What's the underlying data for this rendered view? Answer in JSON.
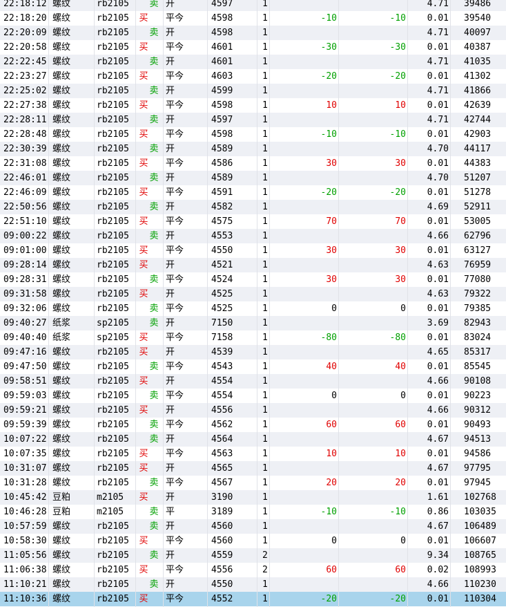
{
  "colors": {
    "buy": "#e00000",
    "sell": "#00a000",
    "profit": "#e00000",
    "loss": "#00a000",
    "row_alt": "#eef0f5",
    "row_selected": "#a8d4ec"
  },
  "rows": [
    {
      "time": "22:18:12",
      "name": "螺纹",
      "code": "rb2105",
      "buy": "",
      "sell": "卖",
      "oc": "开",
      "price": "4597",
      "qty": "1",
      "pl1": "",
      "pl2": "",
      "fee": "4.71",
      "total": "39486"
    },
    {
      "time": "22:18:20",
      "name": "螺纹",
      "code": "rb2105",
      "buy": "买",
      "sell": "",
      "oc": "平今",
      "price": "4598",
      "qty": "1",
      "pl1": "-10",
      "pl2": "-10",
      "fee": "0.01",
      "total": "39540"
    },
    {
      "time": "22:20:09",
      "name": "螺纹",
      "code": "rb2105",
      "buy": "",
      "sell": "卖",
      "oc": "开",
      "price": "4598",
      "qty": "1",
      "pl1": "",
      "pl2": "",
      "fee": "4.71",
      "total": "40097"
    },
    {
      "time": "22:20:58",
      "name": "螺纹",
      "code": "rb2105",
      "buy": "买",
      "sell": "",
      "oc": "平今",
      "price": "4601",
      "qty": "1",
      "pl1": "-30",
      "pl2": "-30",
      "fee": "0.01",
      "total": "40387"
    },
    {
      "time": "22:22:45",
      "name": "螺纹",
      "code": "rb2105",
      "buy": "",
      "sell": "卖",
      "oc": "开",
      "price": "4601",
      "qty": "1",
      "pl1": "",
      "pl2": "",
      "fee": "4.71",
      "total": "41035"
    },
    {
      "time": "22:23:27",
      "name": "螺纹",
      "code": "rb2105",
      "buy": "买",
      "sell": "",
      "oc": "平今",
      "price": "4603",
      "qty": "1",
      "pl1": "-20",
      "pl2": "-20",
      "fee": "0.01",
      "total": "41302"
    },
    {
      "time": "22:25:02",
      "name": "螺纹",
      "code": "rb2105",
      "buy": "",
      "sell": "卖",
      "oc": "开",
      "price": "4599",
      "qty": "1",
      "pl1": "",
      "pl2": "",
      "fee": "4.71",
      "total": "41866"
    },
    {
      "time": "22:27:38",
      "name": "螺纹",
      "code": "rb2105",
      "buy": "买",
      "sell": "",
      "oc": "平今",
      "price": "4598",
      "qty": "1",
      "pl1": "10",
      "pl2": "10",
      "fee": "0.01",
      "total": "42639"
    },
    {
      "time": "22:28:11",
      "name": "螺纹",
      "code": "rb2105",
      "buy": "",
      "sell": "卖",
      "oc": "开",
      "price": "4597",
      "qty": "1",
      "pl1": "",
      "pl2": "",
      "fee": "4.71",
      "total": "42744"
    },
    {
      "time": "22:28:48",
      "name": "螺纹",
      "code": "rb2105",
      "buy": "买",
      "sell": "",
      "oc": "平今",
      "price": "4598",
      "qty": "1",
      "pl1": "-10",
      "pl2": "-10",
      "fee": "0.01",
      "total": "42903"
    },
    {
      "time": "22:30:39",
      "name": "螺纹",
      "code": "rb2105",
      "buy": "",
      "sell": "卖",
      "oc": "开",
      "price": "4589",
      "qty": "1",
      "pl1": "",
      "pl2": "",
      "fee": "4.70",
      "total": "44117"
    },
    {
      "time": "22:31:08",
      "name": "螺纹",
      "code": "rb2105",
      "buy": "买",
      "sell": "",
      "oc": "平今",
      "price": "4586",
      "qty": "1",
      "pl1": "30",
      "pl2": "30",
      "fee": "0.01",
      "total": "44383"
    },
    {
      "time": "22:46:01",
      "name": "螺纹",
      "code": "rb2105",
      "buy": "",
      "sell": "卖",
      "oc": "开",
      "price": "4589",
      "qty": "1",
      "pl1": "",
      "pl2": "",
      "fee": "4.70",
      "total": "51207"
    },
    {
      "time": "22:46:09",
      "name": "螺纹",
      "code": "rb2105",
      "buy": "买",
      "sell": "",
      "oc": "平今",
      "price": "4591",
      "qty": "1",
      "pl1": "-20",
      "pl2": "-20",
      "fee": "0.01",
      "total": "51278"
    },
    {
      "time": "22:50:56",
      "name": "螺纹",
      "code": "rb2105",
      "buy": "",
      "sell": "卖",
      "oc": "开",
      "price": "4582",
      "qty": "1",
      "pl1": "",
      "pl2": "",
      "fee": "4.69",
      "total": "52911"
    },
    {
      "time": "22:51:10",
      "name": "螺纹",
      "code": "rb2105",
      "buy": "买",
      "sell": "",
      "oc": "平今",
      "price": "4575",
      "qty": "1",
      "pl1": "70",
      "pl2": "70",
      "fee": "0.01",
      "total": "53005"
    },
    {
      "time": "09:00:22",
      "name": "螺纹",
      "code": "rb2105",
      "buy": "",
      "sell": "卖",
      "oc": "开",
      "price": "4553",
      "qty": "1",
      "pl1": "",
      "pl2": "",
      "fee": "4.66",
      "total": "62796"
    },
    {
      "time": "09:01:00",
      "name": "螺纹",
      "code": "rb2105",
      "buy": "买",
      "sell": "",
      "oc": "平今",
      "price": "4550",
      "qty": "1",
      "pl1": "30",
      "pl2": "30",
      "fee": "0.01",
      "total": "63127"
    },
    {
      "time": "09:28:14",
      "name": "螺纹",
      "code": "rb2105",
      "buy": "买",
      "sell": "",
      "oc": "开",
      "price": "4521",
      "qty": "1",
      "pl1": "",
      "pl2": "",
      "fee": "4.63",
      "total": "76959"
    },
    {
      "time": "09:28:31",
      "name": "螺纹",
      "code": "rb2105",
      "buy": "",
      "sell": "卖",
      "oc": "平今",
      "price": "4524",
      "qty": "1",
      "pl1": "30",
      "pl2": "30",
      "fee": "0.01",
      "total": "77080"
    },
    {
      "time": "09:31:58",
      "name": "螺纹",
      "code": "rb2105",
      "buy": "买",
      "sell": "",
      "oc": "开",
      "price": "4525",
      "qty": "1",
      "pl1": "",
      "pl2": "",
      "fee": "4.63",
      "total": "79322"
    },
    {
      "time": "09:32:06",
      "name": "螺纹",
      "code": "rb2105",
      "buy": "",
      "sell": "卖",
      "oc": "平今",
      "price": "4525",
      "qty": "1",
      "pl1": "0",
      "pl2": "0",
      "fee": "0.01",
      "total": "79385"
    },
    {
      "time": "09:40:27",
      "name": "纸浆",
      "code": "sp2105",
      "buy": "",
      "sell": "卖",
      "oc": "开",
      "price": "7150",
      "qty": "1",
      "pl1": "",
      "pl2": "",
      "fee": "3.69",
      "total": "82943"
    },
    {
      "time": "09:40:40",
      "name": "纸浆",
      "code": "sp2105",
      "buy": "买",
      "sell": "",
      "oc": "平今",
      "price": "7158",
      "qty": "1",
      "pl1": "-80",
      "pl2": "-80",
      "fee": "0.01",
      "total": "83024"
    },
    {
      "time": "09:47:16",
      "name": "螺纹",
      "code": "rb2105",
      "buy": "买",
      "sell": "",
      "oc": "开",
      "price": "4539",
      "qty": "1",
      "pl1": "",
      "pl2": "",
      "fee": "4.65",
      "total": "85317"
    },
    {
      "time": "09:47:50",
      "name": "螺纹",
      "code": "rb2105",
      "buy": "",
      "sell": "卖",
      "oc": "平今",
      "price": "4543",
      "qty": "1",
      "pl1": "40",
      "pl2": "40",
      "fee": "0.01",
      "total": "85545"
    },
    {
      "time": "09:58:51",
      "name": "螺纹",
      "code": "rb2105",
      "buy": "买",
      "sell": "",
      "oc": "开",
      "price": "4554",
      "qty": "1",
      "pl1": "",
      "pl2": "",
      "fee": "4.66",
      "total": "90108"
    },
    {
      "time": "09:59:03",
      "name": "螺纹",
      "code": "rb2105",
      "buy": "",
      "sell": "卖",
      "oc": "平今",
      "price": "4554",
      "qty": "1",
      "pl1": "0",
      "pl2": "0",
      "fee": "0.01",
      "total": "90223"
    },
    {
      "time": "09:59:21",
      "name": "螺纹",
      "code": "rb2105",
      "buy": "买",
      "sell": "",
      "oc": "开",
      "price": "4556",
      "qty": "1",
      "pl1": "",
      "pl2": "",
      "fee": "4.66",
      "total": "90312"
    },
    {
      "time": "09:59:39",
      "name": "螺纹",
      "code": "rb2105",
      "buy": "",
      "sell": "卖",
      "oc": "平今",
      "price": "4562",
      "qty": "1",
      "pl1": "60",
      "pl2": "60",
      "fee": "0.01",
      "total": "90493"
    },
    {
      "time": "10:07:22",
      "name": "螺纹",
      "code": "rb2105",
      "buy": "",
      "sell": "卖",
      "oc": "开",
      "price": "4564",
      "qty": "1",
      "pl1": "",
      "pl2": "",
      "fee": "4.67",
      "total": "94513"
    },
    {
      "time": "10:07:35",
      "name": "螺纹",
      "code": "rb2105",
      "buy": "买",
      "sell": "",
      "oc": "平今",
      "price": "4563",
      "qty": "1",
      "pl1": "10",
      "pl2": "10",
      "fee": "0.01",
      "total": "94586"
    },
    {
      "time": "10:31:07",
      "name": "螺纹",
      "code": "rb2105",
      "buy": "买",
      "sell": "",
      "oc": "开",
      "price": "4565",
      "qty": "1",
      "pl1": "",
      "pl2": "",
      "fee": "4.67",
      "total": "97795"
    },
    {
      "time": "10:31:28",
      "name": "螺纹",
      "code": "rb2105",
      "buy": "",
      "sell": "卖",
      "oc": "平今",
      "price": "4567",
      "qty": "1",
      "pl1": "20",
      "pl2": "20",
      "fee": "0.01",
      "total": "97945"
    },
    {
      "time": "10:45:42",
      "name": "豆粕",
      "code": "m2105",
      "buy": "买",
      "sell": "",
      "oc": "开",
      "price": "3190",
      "qty": "1",
      "pl1": "",
      "pl2": "",
      "fee": "1.61",
      "total": "102768"
    },
    {
      "time": "10:46:28",
      "name": "豆粕",
      "code": "m2105",
      "buy": "",
      "sell": "卖",
      "oc": "平",
      "price": "3189",
      "qty": "1",
      "pl1": "-10",
      "pl2": "-10",
      "fee": "0.86",
      "total": "103035"
    },
    {
      "time": "10:57:59",
      "name": "螺纹",
      "code": "rb2105",
      "buy": "",
      "sell": "卖",
      "oc": "开",
      "price": "4560",
      "qty": "1",
      "pl1": "",
      "pl2": "",
      "fee": "4.67",
      "total": "106489"
    },
    {
      "time": "10:58:30",
      "name": "螺纹",
      "code": "rb2105",
      "buy": "买",
      "sell": "",
      "oc": "平今",
      "price": "4560",
      "qty": "1",
      "pl1": "0",
      "pl2": "0",
      "fee": "0.01",
      "total": "106607"
    },
    {
      "time": "11:05:56",
      "name": "螺纹",
      "code": "rb2105",
      "buy": "",
      "sell": "卖",
      "oc": "开",
      "price": "4559",
      "qty": "2",
      "pl1": "",
      "pl2": "",
      "fee": "9.34",
      "total": "108765"
    },
    {
      "time": "11:06:38",
      "name": "螺纹",
      "code": "rb2105",
      "buy": "买",
      "sell": "",
      "oc": "平今",
      "price": "4556",
      "qty": "2",
      "pl1": "60",
      "pl2": "60",
      "fee": "0.02",
      "total": "108993"
    },
    {
      "time": "11:10:21",
      "name": "螺纹",
      "code": "rb2105",
      "buy": "",
      "sell": "卖",
      "oc": "开",
      "price": "4550",
      "qty": "1",
      "pl1": "",
      "pl2": "",
      "fee": "4.66",
      "total": "110230"
    },
    {
      "time": "11:10:36",
      "name": "螺纹",
      "code": "rb2105",
      "buy": "买",
      "sell": "",
      "oc": "平今",
      "price": "4552",
      "qty": "1",
      "pl1": "-20",
      "pl2": "-20",
      "fee": "0.01",
      "total": "110304",
      "selected": true
    }
  ]
}
